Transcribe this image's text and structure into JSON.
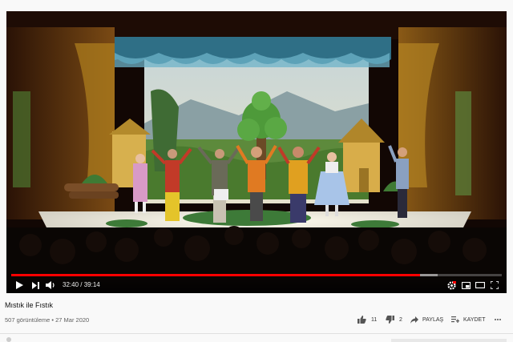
{
  "player": {
    "current_time": "32:40",
    "duration": "39:14",
    "time_separator": " / ",
    "progress_fraction": 0.8326,
    "loaded_fraction": 0.87,
    "accent_color": "#ff0000"
  },
  "video": {
    "title": "Mıstık ile Fıstık",
    "views": "507 görüntüleme",
    "meta_separator": " • ",
    "date": "27 Mar 2020"
  },
  "actions": {
    "like_count": "11",
    "dislike_count": "2",
    "share_label": "PAYLAŞ",
    "save_label": "KAYDET"
  },
  "icons": {
    "play": "play-icon",
    "next": "next-icon",
    "volume": "volume-icon",
    "settings": "gear-icon",
    "miniplayer": "miniplayer-icon",
    "theater": "theater-icon",
    "fullscreen": "fullscreen-icon",
    "like": "thumbs-up-icon",
    "dislike": "thumbs-down-icon",
    "share": "share-icon",
    "save": "playlist-add-icon",
    "more": "more-icon"
  }
}
